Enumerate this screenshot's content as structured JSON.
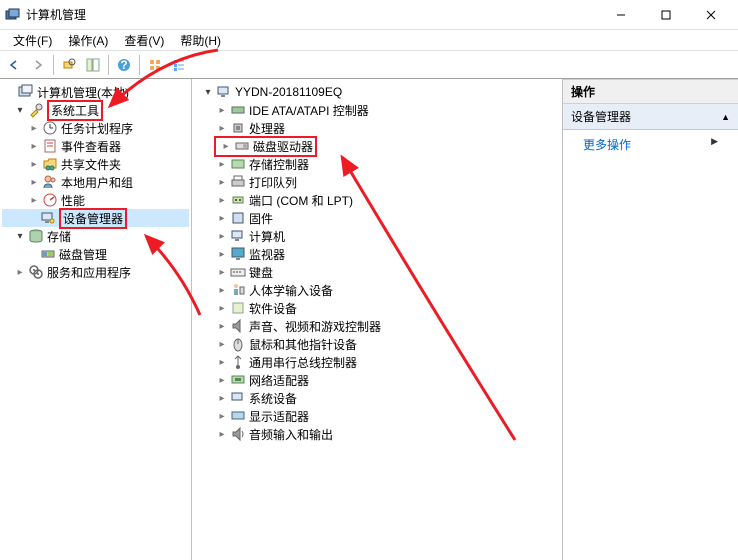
{
  "window": {
    "title": "计算机管理"
  },
  "menu": {
    "file": "文件(F)",
    "action": "操作(A)",
    "view": "查看(V)",
    "help": "帮助(H)"
  },
  "left_tree": {
    "root": "计算机管理(本地)",
    "system_tools": "系统工具",
    "task_scheduler": "任务计划程序",
    "event_viewer": "事件查看器",
    "shared_folders": "共享文件夹",
    "local_users": "本地用户和组",
    "performance": "性能",
    "device_manager": "设备管理器",
    "storage": "存储",
    "disk_management": "磁盘管理",
    "services_apps": "服务和应用程序"
  },
  "mid_tree": {
    "root": "YYDN-20181109EQ",
    "ide": "IDE ATA/ATAPI 控制器",
    "cpu": "处理器",
    "disk": "磁盘驱动器",
    "storage_ctrl": "存储控制器",
    "printers": "打印队列",
    "ports": "端口 (COM 和 LPT)",
    "firmware": "固件",
    "computer": "计算机",
    "monitor": "监视器",
    "keyboard": "键盘",
    "hid": "人体学输入设备",
    "software": "软件设备",
    "audio_video": "声音、视频和游戏控制器",
    "mouse": "鼠标和其他指针设备",
    "usb": "通用串行总线控制器",
    "network": "网络适配器",
    "system_dev": "系统设备",
    "display": "显示适配器",
    "audio_io": "音频输入和输出"
  },
  "right": {
    "header": "操作",
    "section": "设备管理器",
    "more": "更多操作"
  }
}
